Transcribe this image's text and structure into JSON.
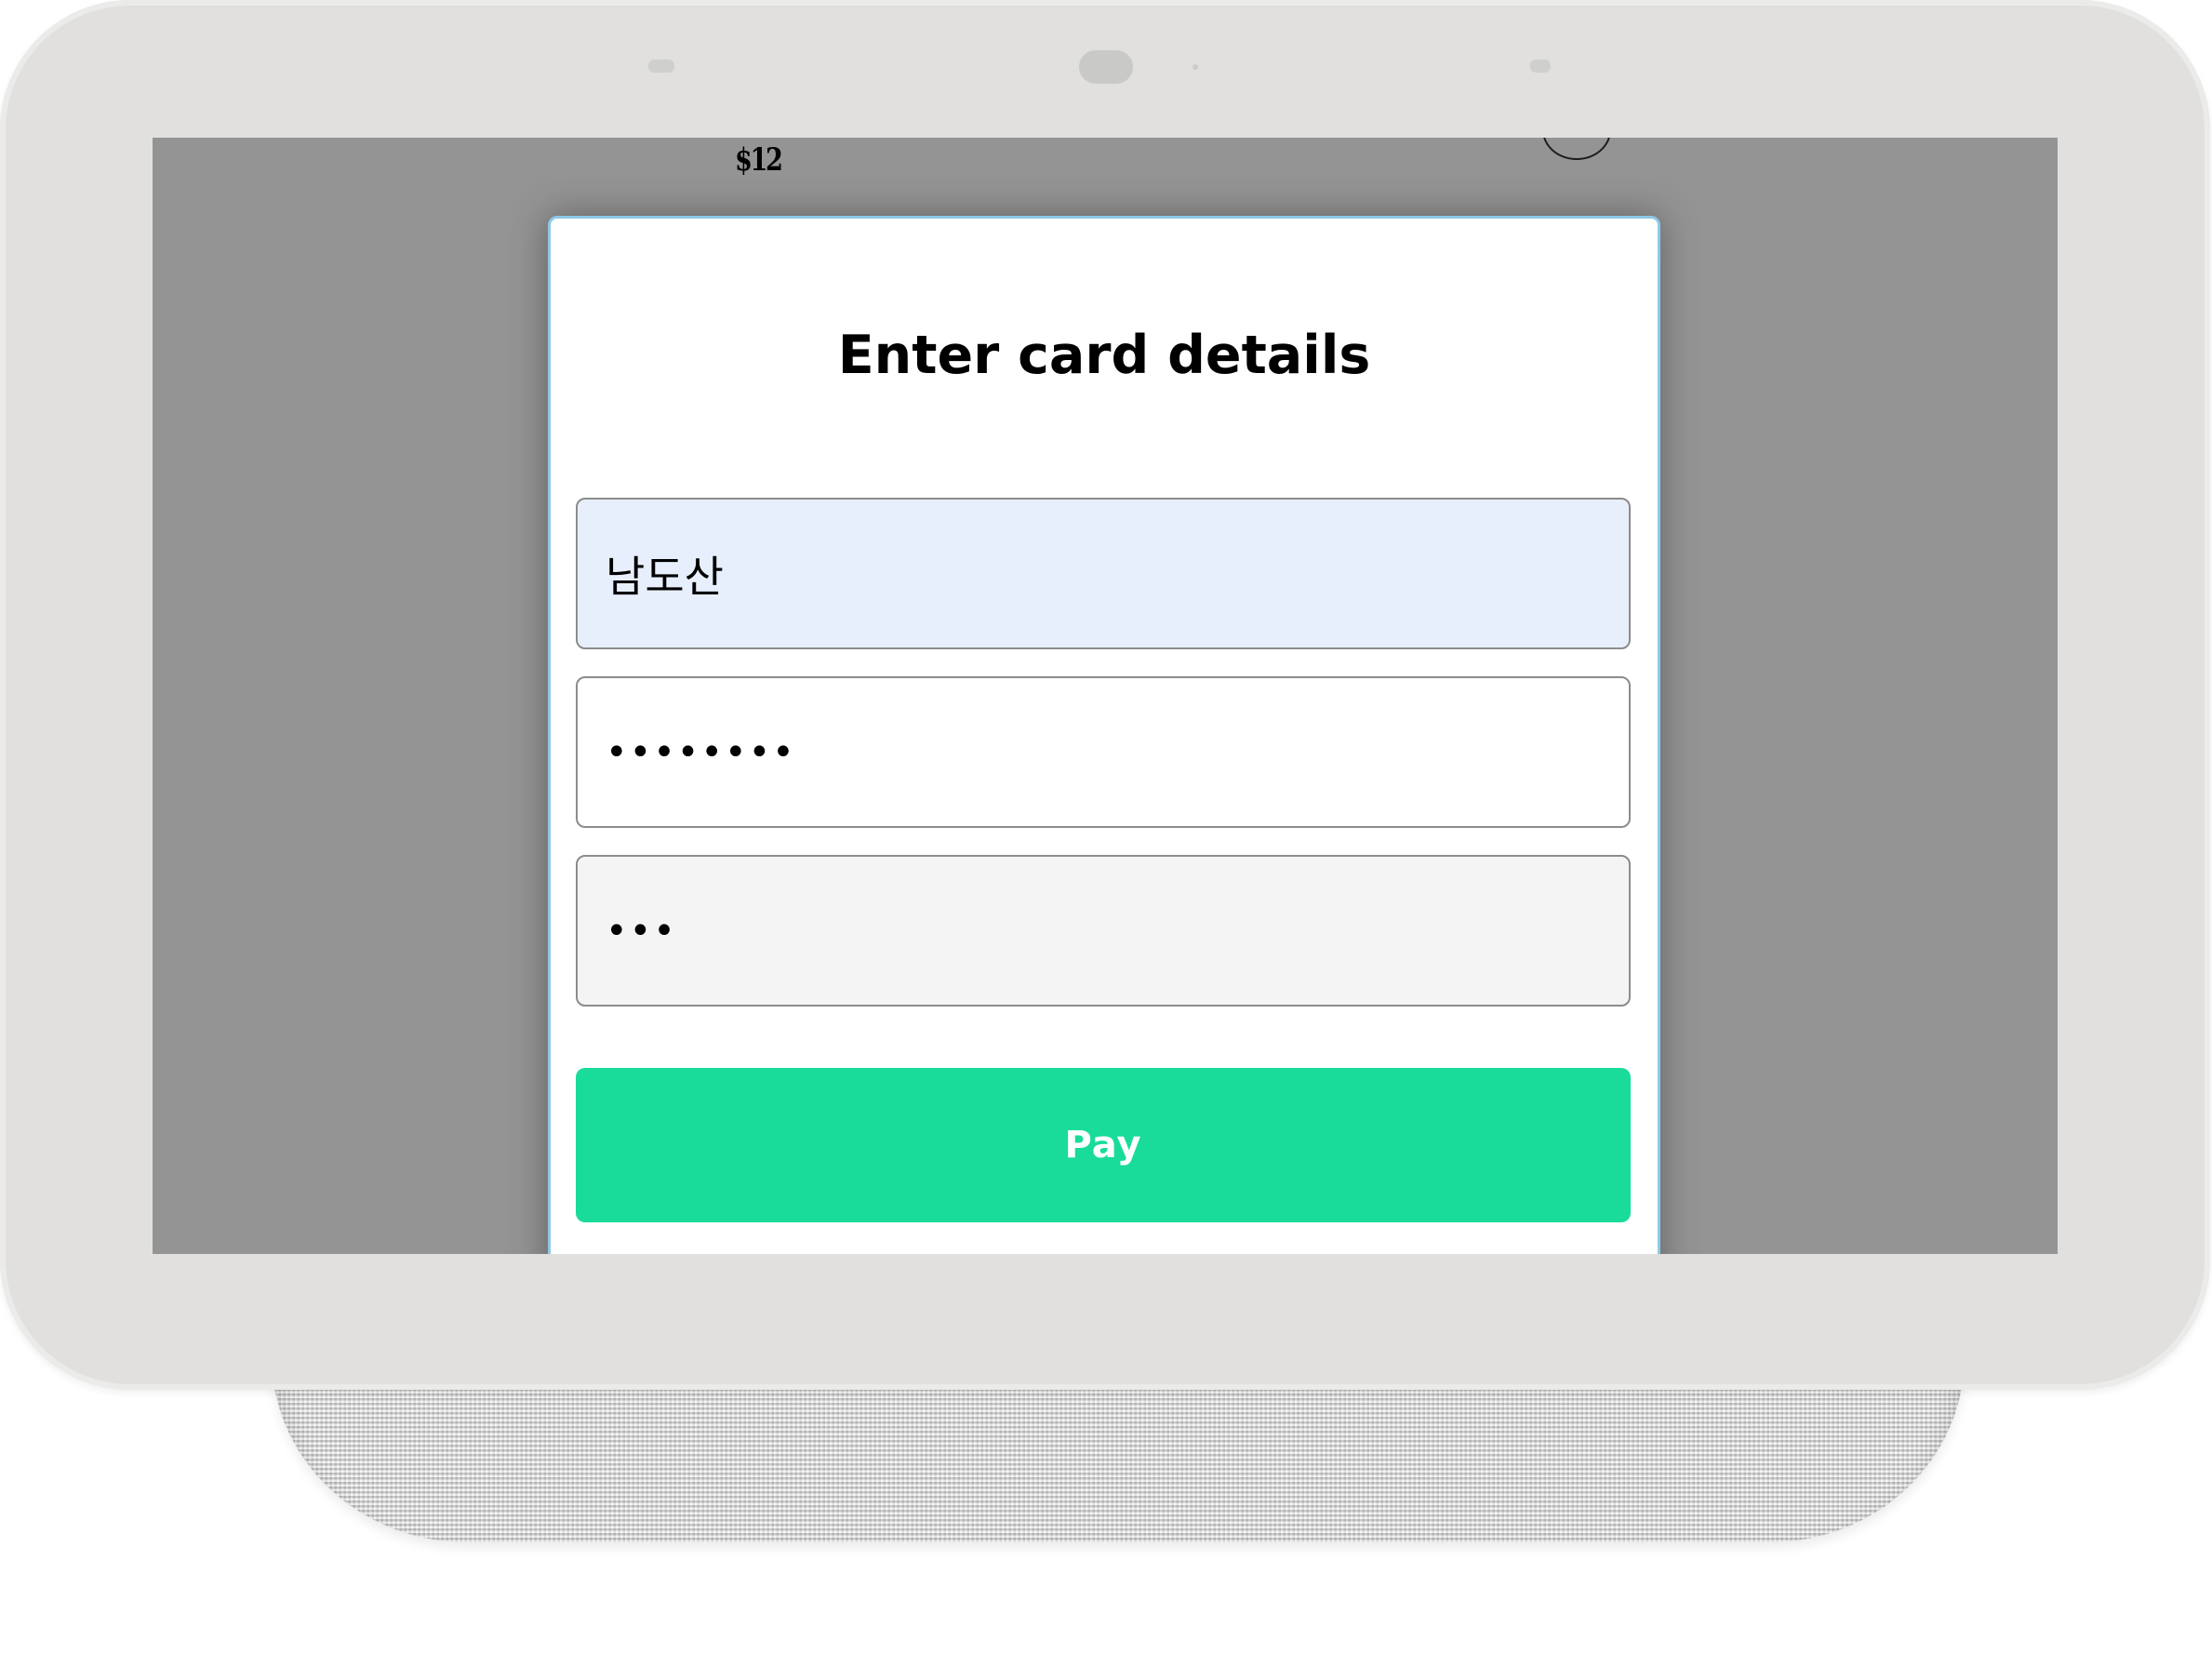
{
  "background_page": {
    "price": "$12"
  },
  "modal": {
    "title": "Enter card details",
    "name_field": {
      "value": "남도산"
    },
    "card_number_field": {
      "value": "12345678"
    },
    "cvv_field": {
      "value": "123"
    },
    "pay_button_label": "Pay"
  },
  "colors": {
    "pay_button": "#19dc9a",
    "name_field_background": "#e8effc",
    "cvv_field_background": "#f4f4f4",
    "modal_border": "#8ec8e6",
    "overlay": "rgba(0,0,0,0.42)"
  },
  "icons": {
    "background_close": "circle-icon"
  }
}
